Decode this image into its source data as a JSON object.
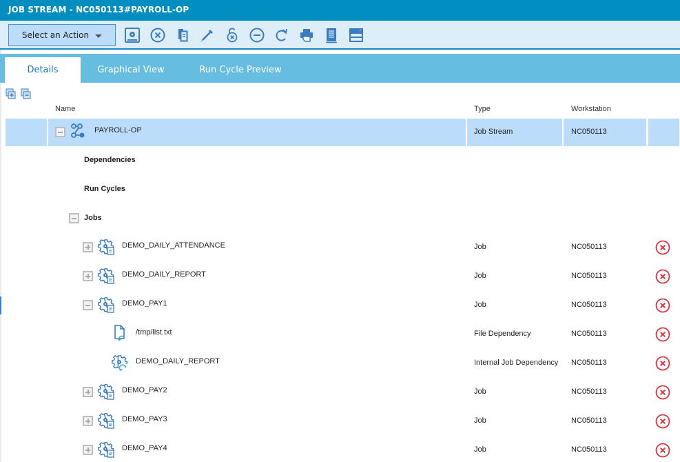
{
  "window": {
    "title": "JOB STREAM - NC050113#PAYROLL-OP"
  },
  "toolbar": {
    "action_label": "Select an Action",
    "icons": [
      {
        "name": "submit-icon",
        "label": "Submit"
      },
      {
        "name": "cancel-icon",
        "label": "Cancel"
      },
      {
        "name": "copy-icon",
        "label": "Copy"
      },
      {
        "name": "edit-icon",
        "label": "Edit"
      },
      {
        "name": "unlock-icon",
        "label": "Unlock"
      },
      {
        "name": "remove-icon",
        "label": "Remove"
      },
      {
        "name": "refresh-icon",
        "label": "Refresh"
      },
      {
        "name": "print-icon",
        "label": "Print"
      },
      {
        "name": "details-icon",
        "label": "Details"
      },
      {
        "name": "server-icon",
        "label": "Workstation"
      }
    ]
  },
  "tabs": [
    {
      "label": "Details",
      "active": true
    },
    {
      "label": "Graphical View",
      "active": false
    },
    {
      "label": "Run Cycle Preview",
      "active": false
    }
  ],
  "table": {
    "headers": {
      "name": "Name",
      "type": "Type",
      "workstation": "Workstation"
    },
    "colors": {
      "accent": "#008dbf",
      "selected": "#bcdcfb",
      "icon": "#3a7cc2",
      "delete": "#e0313f",
      "dep": "#3ab0c8"
    },
    "root": {
      "name": "PAYROLL-OP",
      "type": "Job Stream",
      "workstation": "NC050113",
      "expanded": true
    },
    "sections": [
      {
        "label": "Dependencies"
      },
      {
        "label": "Run Cycles"
      },
      {
        "label": "Jobs",
        "expanded": true
      }
    ],
    "rows": [
      {
        "kind": "job",
        "name": "DEMO_DAILY_ATTENDANCE",
        "type": "Job",
        "workstation": "NC050113",
        "expanded": false
      },
      {
        "kind": "job",
        "name": "DEMO_DAILY_REPORT",
        "type": "Job",
        "workstation": "NC050113",
        "expanded": false
      },
      {
        "kind": "job",
        "name": "DEMO_PAY1",
        "type": "Job",
        "workstation": "NC050113",
        "expanded": true
      },
      {
        "kind": "file-dep",
        "name": "/tmp/list.txt",
        "type": "File Dependency",
        "workstation": "NC050113"
      },
      {
        "kind": "job-dep",
        "name": "DEMO_DAILY_REPORT",
        "type": "Internal Job Dependency",
        "workstation": "NC050113"
      },
      {
        "kind": "job",
        "name": "DEMO_PAY2",
        "type": "Job",
        "workstation": "NC050113",
        "expanded": false
      },
      {
        "kind": "job",
        "name": "DEMO_PAY3",
        "type": "Job",
        "workstation": "NC050113",
        "expanded": false
      },
      {
        "kind": "job",
        "name": "DEMO_PAY4",
        "type": "Job",
        "workstation": "NC050113",
        "expanded": false
      }
    ]
  }
}
